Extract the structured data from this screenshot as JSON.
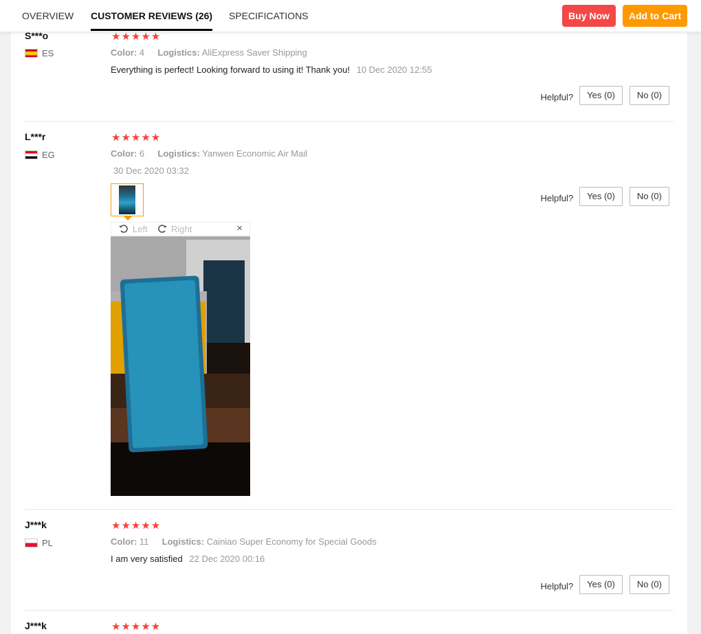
{
  "tabs": [
    {
      "label": "OVERVIEW",
      "active": false
    },
    {
      "label": "CUSTOMER REVIEWS (26)",
      "active": true
    },
    {
      "label": "SPECIFICATIONS",
      "active": false
    }
  ],
  "actions": {
    "buy_now": "Buy Now",
    "add_to_cart": "Add to Cart",
    "buy_color": "#f44747",
    "cart_color": "#ff9900"
  },
  "labels": {
    "color": "Color:",
    "logistics": "Logistics:",
    "helpful": "Helpful?",
    "stars": "★★★★★"
  },
  "reviews": [
    {
      "user": "S***o",
      "country": "ES",
      "flag": "es",
      "rating": 5,
      "color": "4",
      "logistics": "AliExpress Saver Shipping",
      "text": "Everything is perfect! Looking forward to using it! Thank you!",
      "date": "10 Dec 2020 12:55",
      "yes": "Yes (0)",
      "no": "No (0)"
    },
    {
      "user": "L***r",
      "country": "EG",
      "flag": "eg",
      "rating": 5,
      "color": "6",
      "logistics": "Yanwen Economic Air Mail",
      "text": "",
      "date": "30 Dec 2020 03:32",
      "yes": "Yes (0)",
      "no": "No (0)",
      "viewer": {
        "rotate_left": "Left",
        "rotate_right": "Right",
        "close": "×"
      }
    },
    {
      "user": "J***k",
      "country": "PL",
      "flag": "pl",
      "rating": 5,
      "color": "11",
      "logistics": "Cainiao Super Economy for Special Goods",
      "text": "I am very satisfied",
      "date": "22 Dec 2020 00:16",
      "yes": "Yes (0)",
      "no": "No (0)"
    },
    {
      "user": "J***k",
      "rating": 5
    }
  ]
}
